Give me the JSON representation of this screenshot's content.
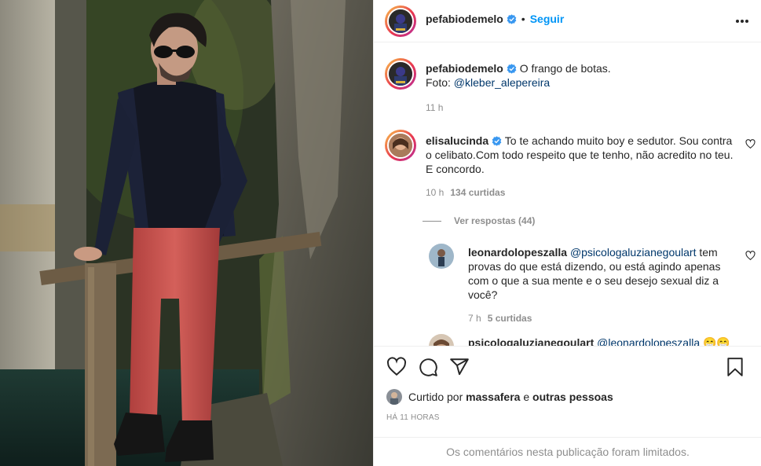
{
  "post": {
    "author": "pefabiodemelo",
    "follow_label": "Seguir",
    "dot": "•",
    "caption_text": "O frango de botas.",
    "caption_foto_label": "Foto: ",
    "caption_mention": "@kleber_alepereira",
    "caption_time": "11 h"
  },
  "comments": [
    {
      "username": "elisalucinda",
      "text": "To te achando muito boy e sedutor. Sou contra o celibato.Com todo respeito que te tenho, não acredito no teu. E concordo.",
      "time": "10 h",
      "likes": "134 curtidas"
    }
  ],
  "view_replies": "Ver respostas (44)",
  "replies": [
    {
      "username": "leonardolopeszalla",
      "mention": "@psicologaluzianegoulart",
      "text": "tem provas do que está dizendo, ou está agindo apenas com o que a sua mente e o seu desejo sexual diz a você?",
      "time": "7 h",
      "likes": "5 curtidas"
    },
    {
      "username": "psicologaluzianegoulart",
      "mention": "@leonardolopeszalla",
      "emoji": "😁😁"
    }
  ],
  "liked_by": {
    "prefix": "Curtido por",
    "user": "massafera",
    "connector": "e",
    "others": "outras pessoas"
  },
  "timestamp": "HÁ 11 HORAS",
  "limited_notice": "Os comentários nesta publicação foram limitados.",
  "colors": {
    "link": "#0095f6",
    "mention": "#00376b",
    "muted": "#8e8e8e",
    "verified": "#3897f0"
  },
  "icons": [
    "verified-badge-icon",
    "more-options-icon",
    "heart-icon",
    "comment-icon",
    "share-icon",
    "bookmark-icon"
  ]
}
